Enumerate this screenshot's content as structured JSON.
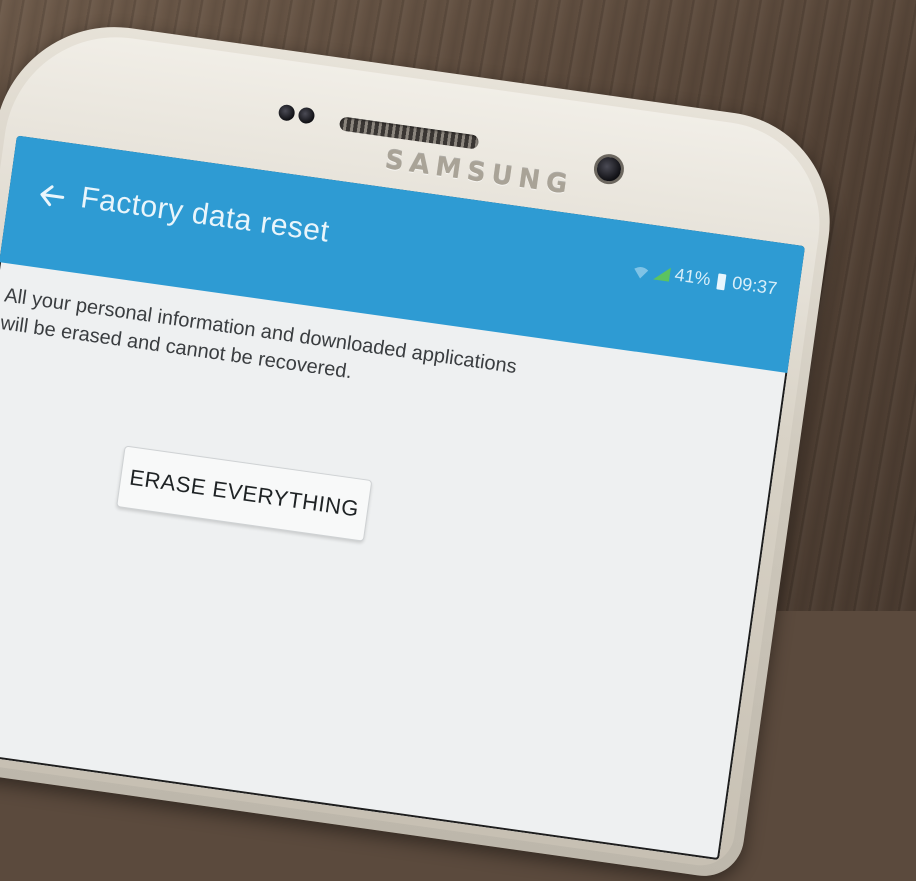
{
  "device": {
    "brand": "SAMSUNG"
  },
  "status_bar": {
    "battery": "41%",
    "time": "09:37"
  },
  "app_bar": {
    "back_icon": "arrow-back-icon",
    "title": "Factory data reset"
  },
  "content": {
    "message": "All your personal information and downloaded applications will be erased and cannot be recovered.",
    "erase_button_label": "ERASE EVERYTHING"
  },
  "colors": {
    "app_bar": "#2e9bd3",
    "screen_background": "#eef0f1"
  }
}
